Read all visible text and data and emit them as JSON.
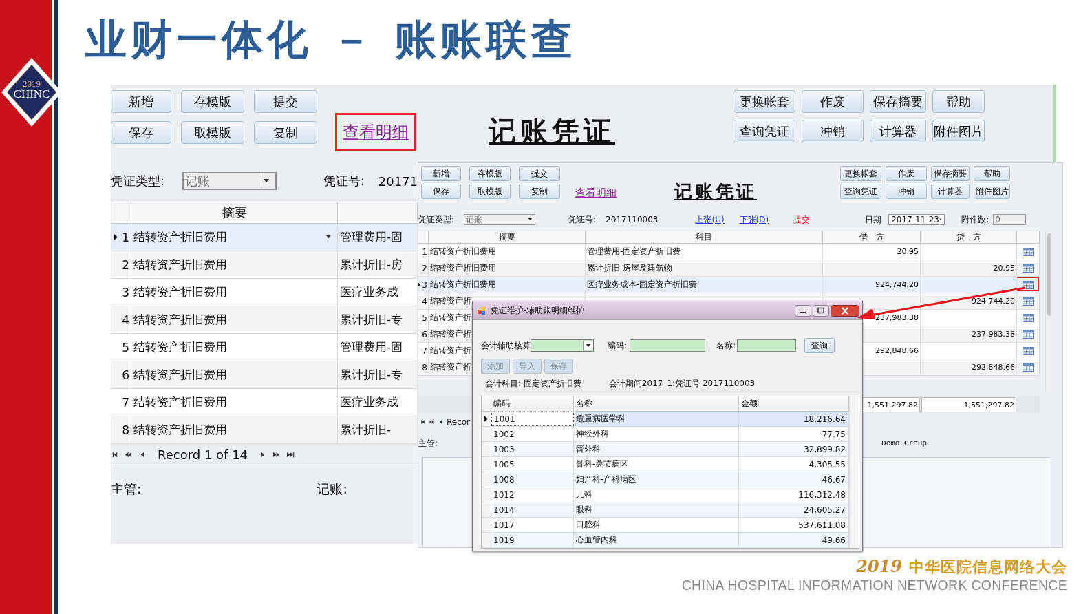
{
  "slide_title": "业财一体化 － 账账联查",
  "logo": {
    "year": "2019",
    "name": "CHINC"
  },
  "main_window": {
    "toolbar_left": [
      [
        "新增",
        "存模版",
        "提交"
      ],
      [
        "保存",
        "取模版",
        "复制"
      ]
    ],
    "detail_link": {
      "label": "查看明细",
      "highlighted": true
    },
    "title": "记账凭证",
    "toolbar_right": [
      [
        "更换帐套",
        "作废",
        "保存摘要",
        "帮助"
      ],
      [
        "查询凭证",
        "冲销",
        "计算器",
        "附件图片"
      ]
    ],
    "voucher_type_label": "凭证类型:",
    "voucher_type": "记账",
    "voucher_no_label": "凭证号:",
    "voucher_no": "20171",
    "summary_header": "摘要",
    "rows": [
      {
        "no": "1",
        "summary": "结转资产折旧费用",
        "account": "管理费用-固",
        "selected": true
      },
      {
        "no": "2",
        "summary": "结转资产折旧费用",
        "account": "累计折旧-房",
        "selected": false
      },
      {
        "no": "3",
        "summary": "结转资产折旧费用",
        "account": "医疗业务成",
        "selected": false
      },
      {
        "no": "4",
        "summary": "结转资产折旧费用",
        "account": "累计折旧-专",
        "selected": false
      },
      {
        "no": "5",
        "summary": "结转资产折旧费用",
        "account": "管理费用-固",
        "selected": false
      },
      {
        "no": "6",
        "summary": "结转资产折旧费用",
        "account": "累计折旧-专",
        "selected": false
      },
      {
        "no": "7",
        "summary": "结转资产折旧费用",
        "account": "医疗业务成",
        "selected": false
      },
      {
        "no": "8",
        "summary": "结转资产折旧费用",
        "account": "累计折旧-",
        "selected": false
      }
    ],
    "record_nav": "Record 1 of 14",
    "footer_labels": [
      "主管:",
      "记账:"
    ]
  },
  "detail_window": {
    "toolbar_left": [
      [
        "新增",
        "存模版",
        "提交"
      ],
      [
        "保存",
        "取模版",
        "复制"
      ]
    ],
    "detail_link": {
      "label": "查看明细",
      "highlighted": false
    },
    "title": "记账凭证",
    "toolbar_right": [
      [
        "更换帐套",
        "作废",
        "保存摘要",
        "帮助"
      ],
      [
        "查询凭证",
        "冲销",
        "计算器",
        "附件图片"
      ]
    ],
    "voucher_type_label": "凭证类型:",
    "voucher_type": "记账",
    "voucher_no_label": "凭证号:",
    "voucher_no": "2017110003",
    "prev_link": "上张(U)",
    "next_link": "下张(D)",
    "submit_label": "提交",
    "date_label": "日期",
    "date": "2017-11-23",
    "attachments_label": "附件数:",
    "attachments": "0",
    "columns": [
      "摘要",
      "科目",
      "借　方",
      "贷　方"
    ],
    "rows": [
      {
        "no": "1",
        "summary": "结转资产折旧费用",
        "account": "管理费用-固定资产折旧费",
        "debit": "20.95",
        "selected": false,
        "flagged": false
      },
      {
        "no": "2",
        "summary": "结转资产折旧费用",
        "account": "累计折旧-房屋及建筑物",
        "credit": "20.95",
        "selected": false,
        "flagged": false
      },
      {
        "no": "3",
        "summary": "结转资产折旧费用",
        "account": "医疗业务成本-固定资产折旧费",
        "debit": "924,744.20",
        "selected": true,
        "flagged": true
      },
      {
        "no": "4",
        "summary": "结转资产折",
        "credit": "924,744.20",
        "selected": false,
        "flagged": false
      },
      {
        "no": "5",
        "summary": "结转资产折",
        "debit": "237,983.38",
        "selected": false,
        "flagged": false
      },
      {
        "no": "6",
        "summary": "结转资产折",
        "credit": "237,983.38",
        "selected": false,
        "flagged": false
      },
      {
        "no": "7",
        "summary": "结转资产折",
        "debit": "292,848.66",
        "selected": false,
        "flagged": false
      },
      {
        "no": "8",
        "summary": "结转资产折",
        "credit": "292,848.66",
        "selected": false,
        "flagged": false
      }
    ],
    "total_debit": "1,551,297.82",
    "total_credit": "1,551,297.82",
    "record_nav": "Recor",
    "footer_label": "主管:",
    "group": "Demo Group"
  },
  "dialog": {
    "title": "凭证维护-辅助账明细维护",
    "category_label": "会计辅助核算",
    "code_label": "编码:",
    "name_label": "名称:",
    "query_button": "查询",
    "buttons": [
      {
        "label": "添加",
        "disabled": true
      },
      {
        "label": "导入",
        "disabled": true
      },
      {
        "label": "保存",
        "disabled": true
      }
    ],
    "account_info": "会计科目: 固定资产折旧费",
    "period_info": "会计期间2017_1:凭证号 2017110003",
    "columns": [
      "编码",
      "名称",
      "金额"
    ],
    "rows": [
      {
        "code": "1001",
        "name": "危重病医学科",
        "amount": "18,216.64",
        "selected": true
      },
      {
        "code": "1002",
        "name": "神经外科",
        "amount": "77.75",
        "selected": false
      },
      {
        "code": "1003",
        "name": "普外科",
        "amount": "32,899.82",
        "selected": false
      },
      {
        "code": "1005",
        "name": "骨科-关节病区",
        "amount": "4,305.55",
        "selected": false
      },
      {
        "code": "1008",
        "name": "妇产科-产科病区",
        "amount": "46.67",
        "selected": false
      },
      {
        "code": "1012",
        "name": "儿科",
        "amount": "116,312.48",
        "selected": false
      },
      {
        "code": "1014",
        "name": "眼科",
        "amount": "24,605.27",
        "selected": false
      },
      {
        "code": "1017",
        "name": "口腔科",
        "amount": "537,611.08",
        "selected": false
      },
      {
        "code": "1019",
        "name": "心血管内科",
        "amount": "49.66",
        "selected": false
      }
    ]
  },
  "footer": {
    "year": "2019",
    "name_cn": "中华医院信息网络大会",
    "name_en": "CHINA HOSPITAL INFORMATION NETWORK CONFERENCE"
  }
}
